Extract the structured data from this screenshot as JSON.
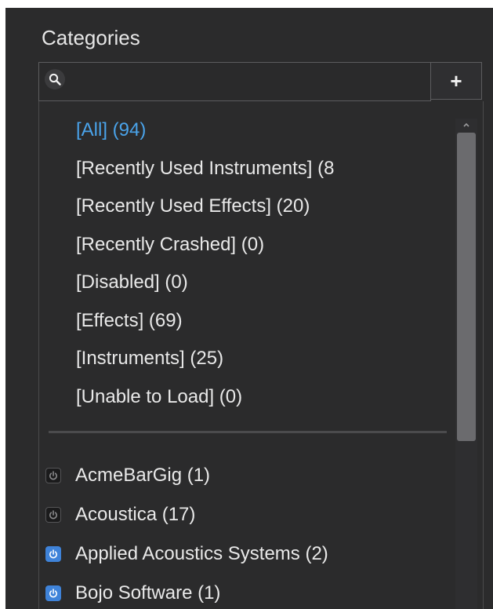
{
  "panel": {
    "title": "Categories",
    "search": {
      "value": "",
      "placeholder": "",
      "icon": "search-icon"
    },
    "add_button_label": "+",
    "special_categories": [
      {
        "label": "[All] (94)",
        "selected": true
      },
      {
        "label": "[Recently Used Instruments] (8",
        "selected": false
      },
      {
        "label": "[Recently Used Effects] (20)",
        "selected": false
      },
      {
        "label": "[Recently Crashed] (0)",
        "selected": false
      },
      {
        "label": "[Disabled] (0)",
        "selected": false
      },
      {
        "label": "[Effects] (69)",
        "selected": false
      },
      {
        "label": "[Instruments] (25)",
        "selected": false
      },
      {
        "label": "[Unable to Load] (0)",
        "selected": false
      }
    ],
    "vendors": [
      {
        "label": "AcmeBarGig (1)",
        "enabled": false
      },
      {
        "label": "Acoustica (17)",
        "enabled": false
      },
      {
        "label": "Applied Acoustics Systems (2)",
        "enabled": true
      },
      {
        "label": "Bojo Software (1)",
        "enabled": true
      }
    ],
    "colors": {
      "background": "#2b2b2c",
      "text": "#e9e9e9",
      "selected_text": "#4aa3ea",
      "toggle_on": "#3f83d9",
      "toggle_off": "#1b1b1c"
    }
  }
}
